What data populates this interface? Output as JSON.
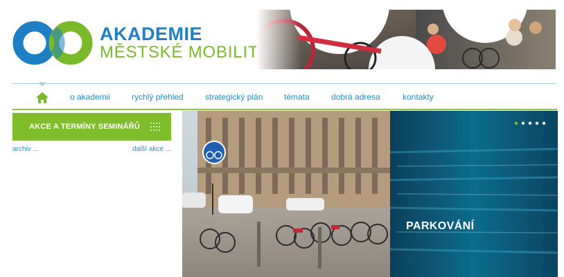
{
  "logo": {
    "line1": "AKADEMIE",
    "line2": "MĚSTSKÉ MOBILITY",
    "primary_color": "#1f7fc4",
    "secondary_color": "#7ab929"
  },
  "nav": {
    "home_icon": "home-icon",
    "items": [
      {
        "label": "o akademii"
      },
      {
        "label": "rychlý přehled"
      },
      {
        "label": "strategický plán"
      },
      {
        "label": "témata"
      },
      {
        "label": "dobrá adresa"
      },
      {
        "label": "kontakty"
      }
    ],
    "link_color": "#1f8fc8",
    "accent_color": "#8cc63f"
  },
  "events": {
    "title": "AKCE A TERMÍNY SEMINÁŘŮ",
    "icon": "grid-icon",
    "archive_link": "archiv ...",
    "more_link": "další akce ...",
    "box_color": "#7fbd2a"
  },
  "banner": {
    "caption": "PARKOVÁNÍ",
    "overlay_color": "#0b4f70",
    "slide_count": 5,
    "active_slide": 1
  }
}
